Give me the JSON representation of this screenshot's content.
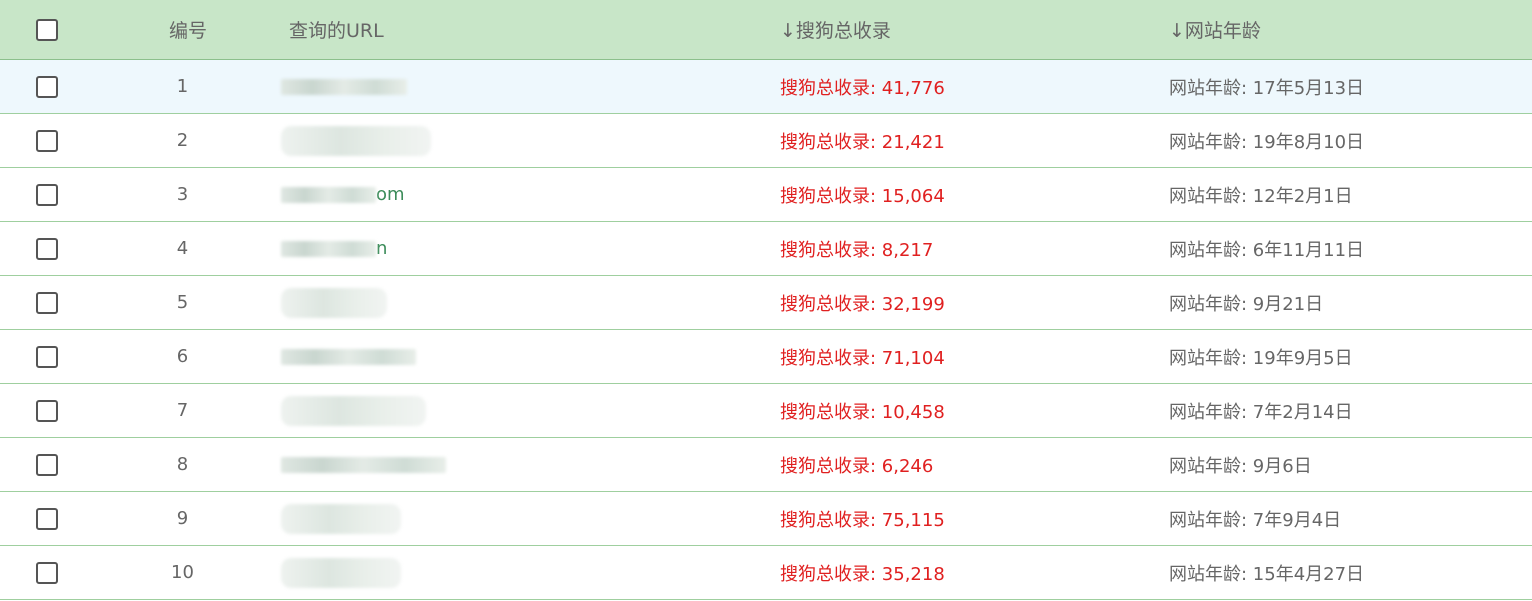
{
  "header": {
    "num": "编号",
    "url": "查询的URL",
    "sogou": "↓搜狗总收录",
    "age": "↓网站年龄"
  },
  "rows": [
    {
      "num": "1",
      "url_visible": "",
      "sogou": "搜狗总收录: 41,776",
      "age": "网站年龄: 17年5月13日"
    },
    {
      "num": "2",
      "url_visible": "",
      "sogou": "搜狗总收录: 21,421",
      "age": "网站年龄: 19年8月10日"
    },
    {
      "num": "3",
      "url_visible": "om",
      "sogou": "搜狗总收录: 15,064",
      "age": "网站年龄: 12年2月1日"
    },
    {
      "num": "4",
      "url_visible": "n",
      "sogou": "搜狗总收录: 8,217",
      "age": "网站年龄: 6年11月11日"
    },
    {
      "num": "5",
      "url_visible": "",
      "sogou": "搜狗总收录: 32,199",
      "age": "网站年龄: 9月21日"
    },
    {
      "num": "6",
      "url_visible": "",
      "sogou": "搜狗总收录: 71,104",
      "age": "网站年龄: 19年9月5日"
    },
    {
      "num": "7",
      "url_visible": "",
      "sogou": "搜狗总收录: 10,458",
      "age": "网站年龄: 7年2月14日"
    },
    {
      "num": "8",
      "url_visible": "",
      "sogou": "搜狗总收录: 6,246",
      "age": "网站年龄: 9月6日"
    },
    {
      "num": "9",
      "url_visible": "",
      "sogou": "搜狗总收录: 75,115",
      "age": "网站年龄: 7年9月4日"
    },
    {
      "num": "10",
      "url_visible": "",
      "sogou": "搜狗总收录: 35,218",
      "age": "网站年龄: 15年4月27日"
    }
  ],
  "colors": {
    "header_bg": "#c8e6c8",
    "row_highlight": "#eef8fd",
    "sogou_text": "#e02020",
    "age_text": "#666666",
    "row_border": "#9fcf9f"
  }
}
